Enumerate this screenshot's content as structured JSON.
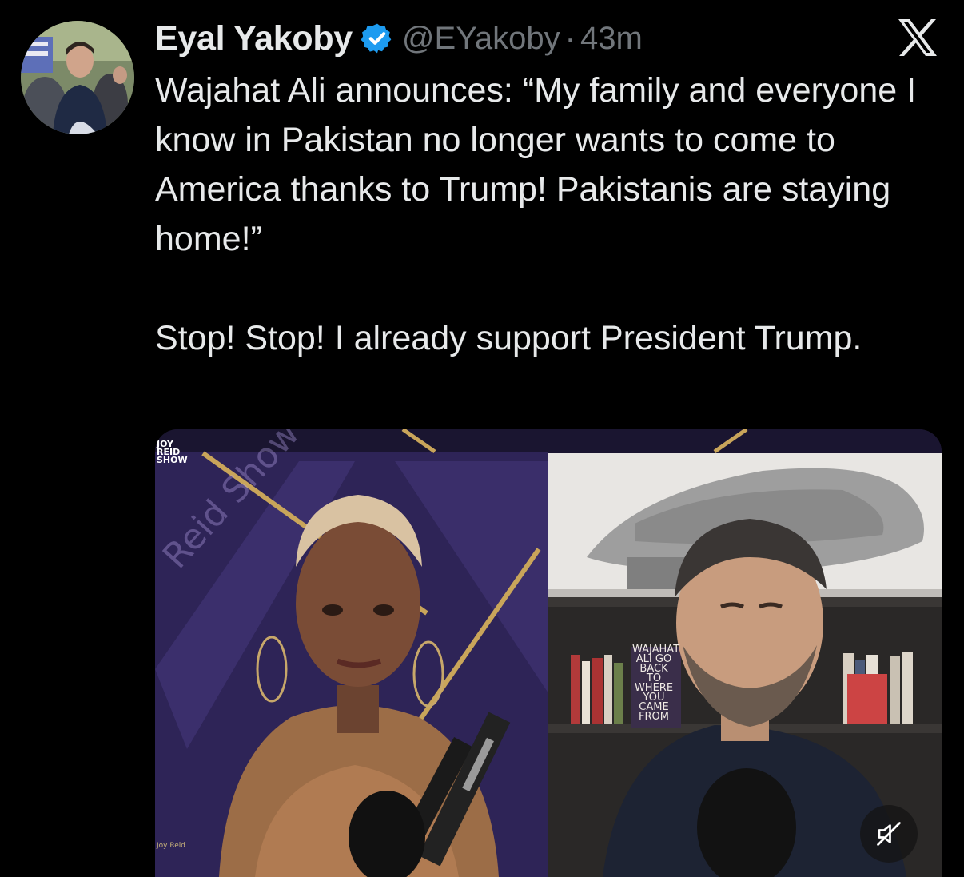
{
  "tweet": {
    "author_name": "Eyal Yakoby",
    "handle": "@EYakoby",
    "separator": "·",
    "time": "43m",
    "text_lines": [
      "Wajahat Ali announces: “My family and everyone I know in Pakistan no longer wants to come to America thanks to Trump! Pakistanis are staying home!”",
      "Stop! Stop! I already support President Trump."
    ]
  },
  "icons": {
    "verified": "verified-badge-icon",
    "x_logo": "x-logo-icon",
    "mute": "muted-speaker-icon"
  },
  "media": {
    "show_logo": "JOY REID SHOW",
    "watermark_text": "Reid Show",
    "host_lower_third": "Joy Reid",
    "book_title": "WAJAHAT ALI GO BACK TO WHERE YOU CAME FROM"
  },
  "colors": {
    "background": "#000000",
    "primary_text": "#e7e9ea",
    "secondary_text": "#71767b",
    "verified_blue": "#1d9bf0"
  }
}
